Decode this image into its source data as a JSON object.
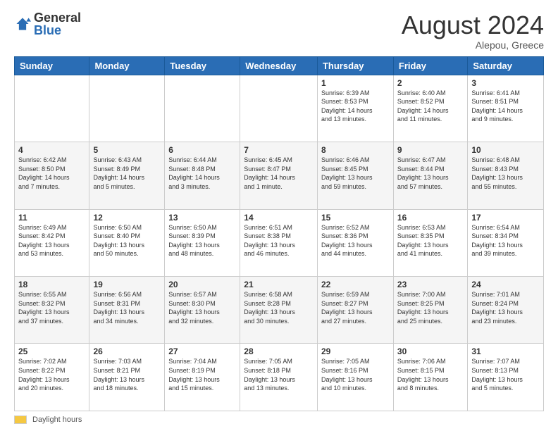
{
  "logo": {
    "general": "General",
    "blue": "Blue"
  },
  "header": {
    "month_year": "August 2024",
    "location": "Alepou, Greece"
  },
  "days_header": [
    "Sunday",
    "Monday",
    "Tuesday",
    "Wednesday",
    "Thursday",
    "Friday",
    "Saturday"
  ],
  "weeks": [
    [
      {
        "num": "",
        "info": ""
      },
      {
        "num": "",
        "info": ""
      },
      {
        "num": "",
        "info": ""
      },
      {
        "num": "",
        "info": ""
      },
      {
        "num": "1",
        "info": "Sunrise: 6:39 AM\nSunset: 8:53 PM\nDaylight: 14 hours\nand 13 minutes."
      },
      {
        "num": "2",
        "info": "Sunrise: 6:40 AM\nSunset: 8:52 PM\nDaylight: 14 hours\nand 11 minutes."
      },
      {
        "num": "3",
        "info": "Sunrise: 6:41 AM\nSunset: 8:51 PM\nDaylight: 14 hours\nand 9 minutes."
      }
    ],
    [
      {
        "num": "4",
        "info": "Sunrise: 6:42 AM\nSunset: 8:50 PM\nDaylight: 14 hours\nand 7 minutes."
      },
      {
        "num": "5",
        "info": "Sunrise: 6:43 AM\nSunset: 8:49 PM\nDaylight: 14 hours\nand 5 minutes."
      },
      {
        "num": "6",
        "info": "Sunrise: 6:44 AM\nSunset: 8:48 PM\nDaylight: 14 hours\nand 3 minutes."
      },
      {
        "num": "7",
        "info": "Sunrise: 6:45 AM\nSunset: 8:47 PM\nDaylight: 14 hours\nand 1 minute."
      },
      {
        "num": "8",
        "info": "Sunrise: 6:46 AM\nSunset: 8:45 PM\nDaylight: 13 hours\nand 59 minutes."
      },
      {
        "num": "9",
        "info": "Sunrise: 6:47 AM\nSunset: 8:44 PM\nDaylight: 13 hours\nand 57 minutes."
      },
      {
        "num": "10",
        "info": "Sunrise: 6:48 AM\nSunset: 8:43 PM\nDaylight: 13 hours\nand 55 minutes."
      }
    ],
    [
      {
        "num": "11",
        "info": "Sunrise: 6:49 AM\nSunset: 8:42 PM\nDaylight: 13 hours\nand 53 minutes."
      },
      {
        "num": "12",
        "info": "Sunrise: 6:50 AM\nSunset: 8:40 PM\nDaylight: 13 hours\nand 50 minutes."
      },
      {
        "num": "13",
        "info": "Sunrise: 6:50 AM\nSunset: 8:39 PM\nDaylight: 13 hours\nand 48 minutes."
      },
      {
        "num": "14",
        "info": "Sunrise: 6:51 AM\nSunset: 8:38 PM\nDaylight: 13 hours\nand 46 minutes."
      },
      {
        "num": "15",
        "info": "Sunrise: 6:52 AM\nSunset: 8:36 PM\nDaylight: 13 hours\nand 44 minutes."
      },
      {
        "num": "16",
        "info": "Sunrise: 6:53 AM\nSunset: 8:35 PM\nDaylight: 13 hours\nand 41 minutes."
      },
      {
        "num": "17",
        "info": "Sunrise: 6:54 AM\nSunset: 8:34 PM\nDaylight: 13 hours\nand 39 minutes."
      }
    ],
    [
      {
        "num": "18",
        "info": "Sunrise: 6:55 AM\nSunset: 8:32 PM\nDaylight: 13 hours\nand 37 minutes."
      },
      {
        "num": "19",
        "info": "Sunrise: 6:56 AM\nSunset: 8:31 PM\nDaylight: 13 hours\nand 34 minutes."
      },
      {
        "num": "20",
        "info": "Sunrise: 6:57 AM\nSunset: 8:30 PM\nDaylight: 13 hours\nand 32 minutes."
      },
      {
        "num": "21",
        "info": "Sunrise: 6:58 AM\nSunset: 8:28 PM\nDaylight: 13 hours\nand 30 minutes."
      },
      {
        "num": "22",
        "info": "Sunrise: 6:59 AM\nSunset: 8:27 PM\nDaylight: 13 hours\nand 27 minutes."
      },
      {
        "num": "23",
        "info": "Sunrise: 7:00 AM\nSunset: 8:25 PM\nDaylight: 13 hours\nand 25 minutes."
      },
      {
        "num": "24",
        "info": "Sunrise: 7:01 AM\nSunset: 8:24 PM\nDaylight: 13 hours\nand 23 minutes."
      }
    ],
    [
      {
        "num": "25",
        "info": "Sunrise: 7:02 AM\nSunset: 8:22 PM\nDaylight: 13 hours\nand 20 minutes."
      },
      {
        "num": "26",
        "info": "Sunrise: 7:03 AM\nSunset: 8:21 PM\nDaylight: 13 hours\nand 18 minutes."
      },
      {
        "num": "27",
        "info": "Sunrise: 7:04 AM\nSunset: 8:19 PM\nDaylight: 13 hours\nand 15 minutes."
      },
      {
        "num": "28",
        "info": "Sunrise: 7:05 AM\nSunset: 8:18 PM\nDaylight: 13 hours\nand 13 minutes."
      },
      {
        "num": "29",
        "info": "Sunrise: 7:05 AM\nSunset: 8:16 PM\nDaylight: 13 hours\nand 10 minutes."
      },
      {
        "num": "30",
        "info": "Sunrise: 7:06 AM\nSunset: 8:15 PM\nDaylight: 13 hours\nand 8 minutes."
      },
      {
        "num": "31",
        "info": "Sunrise: 7:07 AM\nSunset: 8:13 PM\nDaylight: 13 hours\nand 5 minutes."
      }
    ]
  ],
  "footer": {
    "label": "Daylight hours"
  }
}
